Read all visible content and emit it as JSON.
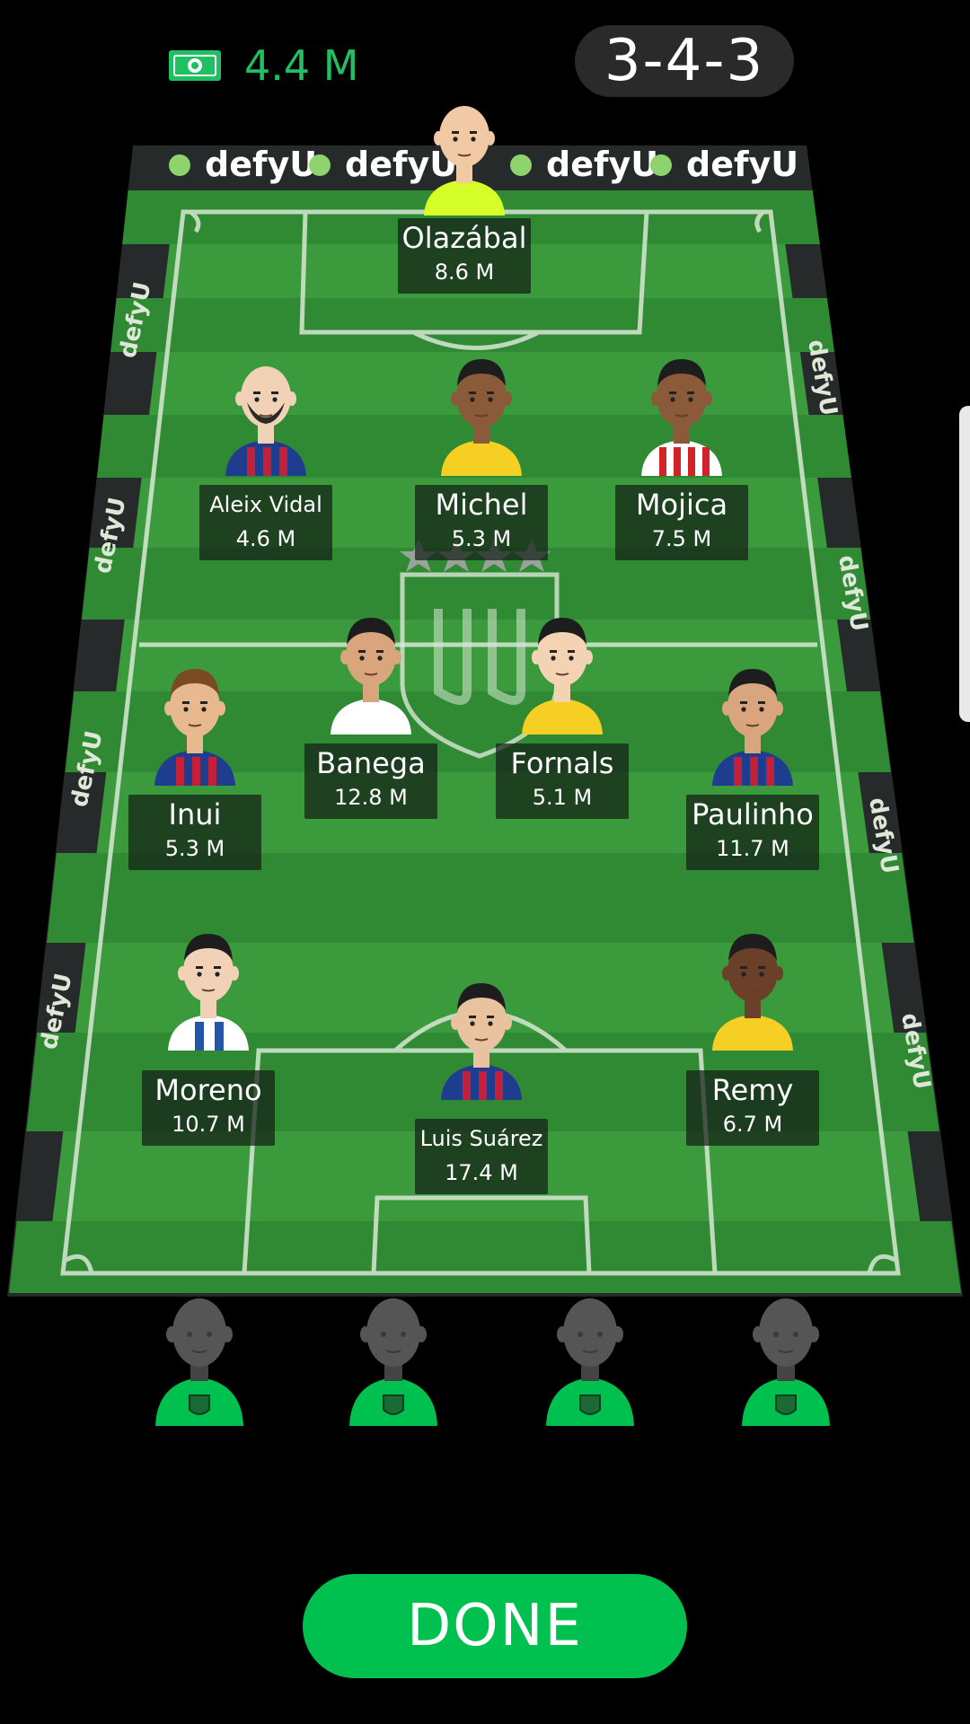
{
  "header": {
    "budget": "4.4 M",
    "formation": "3-4-3"
  },
  "pitch": {
    "brand": "defyU"
  },
  "players": [
    {
      "name": "Olazábal",
      "price": "8.6 M",
      "shirt": "#d6ff2a",
      "stripe": "none",
      "skin": "#f1c9a5",
      "hair": "bald"
    },
    {
      "name": "Aleix Vidal",
      "price": "4.6 M",
      "shirt": "#1f3d8f",
      "stripe": "red",
      "skin": "#f1d2b6",
      "hair": "bald-beard"
    },
    {
      "name": "Michel",
      "price": "5.3 M",
      "shirt": "#f6cf24",
      "stripe": "none",
      "skin": "#8a5a3b",
      "hair": "dark"
    },
    {
      "name": "Mojica",
      "price": "7.5 M",
      "shirt": "#ffffff",
      "stripe": "redwhite",
      "skin": "#8a5a3b",
      "hair": "dark"
    },
    {
      "name": "Inui",
      "price": "5.3 M",
      "shirt": "#1f3d8f",
      "stripe": "red",
      "skin": "#e8b98e",
      "hair": "brown"
    },
    {
      "name": "Banega",
      "price": "12.8 M",
      "shirt": "#ffffff",
      "stripe": "none",
      "skin": "#d9a57c",
      "hair": "dark"
    },
    {
      "name": "Fornals",
      "price": "5.1 M",
      "shirt": "#f6cf24",
      "stripe": "none",
      "skin": "#f4d3b4",
      "hair": "dark"
    },
    {
      "name": "Paulinho",
      "price": "11.7 M",
      "shirt": "#1f3d8f",
      "stripe": "red",
      "skin": "#d9a57c",
      "hair": "dark"
    },
    {
      "name": "Moreno",
      "price": "10.7 M",
      "shirt": "#ffffff",
      "stripe": "blue",
      "skin": "#f1d2b6",
      "hair": "dark"
    },
    {
      "name": "Luis Suárez",
      "price": "17.4 M",
      "shirt": "#1f3d8f",
      "stripe": "red",
      "skin": "#e9c2a0",
      "hair": "dark"
    },
    {
      "name": "Remy",
      "price": "6.7 M",
      "shirt": "#f6cf24",
      "stripe": "none",
      "skin": "#6b4028",
      "hair": "dark"
    }
  ],
  "bench": [
    {
      "label": "empty"
    },
    {
      "label": "empty"
    },
    {
      "label": "empty"
    },
    {
      "label": "empty"
    }
  ],
  "done_label": "DONE",
  "colors": {
    "accent": "#00c04f",
    "budget": "#1fbf62",
    "pitch_dark": "#2b7d2f",
    "pitch_light": "#3c9a3b"
  }
}
